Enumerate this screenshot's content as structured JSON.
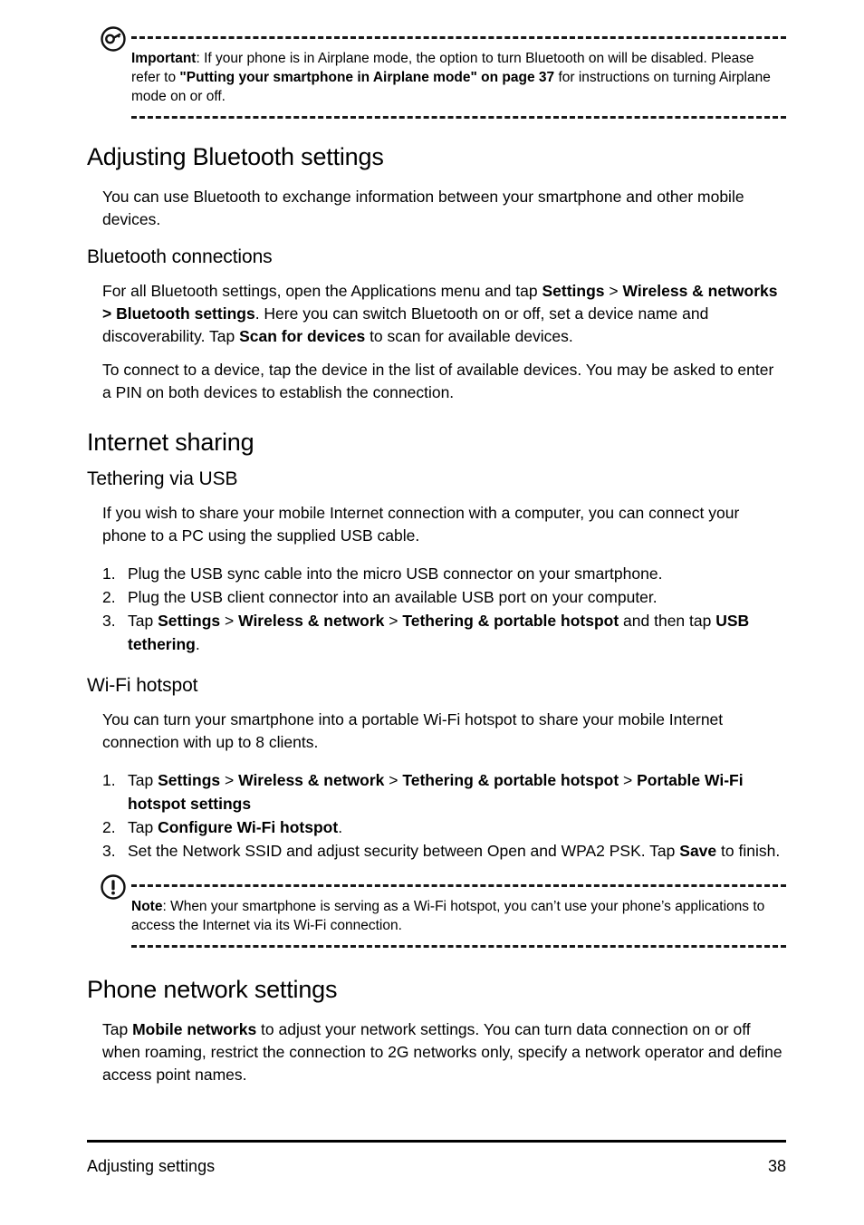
{
  "page": {
    "number": "38",
    "footer_left": "Adjusting settings"
  },
  "important_box": {
    "icon": "key-in-circle-icon",
    "label": "Important",
    "text_1": ": If your phone is in Airplane mode, the option to turn Bluetooth on will be disabled. Please refer to ",
    "bold_ref": "\"Putting your smartphone in Airplane mode\" on page 37",
    "text_2": " for instructions on turning Airplane mode on or off."
  },
  "sections": {
    "bluetooth": {
      "heading": "Adjusting Bluetooth settings",
      "intro": "You can use Bluetooth to exchange information between your smartphone and other mobile devices.",
      "sub_heading": "Bluetooth connections",
      "para1_a": "For all Bluetooth settings, open the Applications menu and tap ",
      "para1_b": "Settings",
      "para1_c": " > ",
      "para1_d": "Wireless & networks > Bluetooth settings",
      "para1_e": ". Here you can switch Bluetooth on or off, set a device name and discoverability. Tap ",
      "para1_f": "Scan for devices",
      "para1_g": " to scan for available devices.",
      "para2": "To connect to a device, tap the device in the list of available devices. You may be asked to enter a PIN on both devices to establish the connection."
    },
    "internet_sharing": {
      "heading": "Internet sharing",
      "usb": {
        "sub_heading": "Tethering via USB",
        "intro": "If you wish to share your mobile Internet connection with a computer, you can connect your phone to a PC using the supplied USB cable.",
        "steps": [
          {
            "num": "1.",
            "parts": [
              {
                "text": "Plug the USB sync cable into the micro USB connector on your smartphone.",
                "bold": false
              }
            ]
          },
          {
            "num": "2.",
            "parts": [
              {
                "text": "Plug the USB client connector into an available USB port on your computer.",
                "bold": false
              }
            ]
          },
          {
            "num": "3.",
            "parts": [
              {
                "text": "Tap ",
                "bold": false
              },
              {
                "text": "Settings",
                "bold": true
              },
              {
                "text": " > ",
                "bold": false
              },
              {
                "text": "Wireless & network",
                "bold": true
              },
              {
                "text": " > ",
                "bold": false
              },
              {
                "text": "Tethering & portable hotspot",
                "bold": true
              },
              {
                "text": " and then tap ",
                "bold": false
              },
              {
                "text": "USB tethering",
                "bold": true
              },
              {
                "text": ".",
                "bold": false
              }
            ]
          }
        ]
      },
      "wifi": {
        "sub_heading": "Wi-Fi hotspot",
        "intro": "You can turn your smartphone into a portable Wi-Fi hotspot to share your mobile Internet connection with up to 8 clients.",
        "steps": [
          {
            "num": "1.",
            "parts": [
              {
                "text": "Tap ",
                "bold": false
              },
              {
                "text": "Settings",
                "bold": true
              },
              {
                "text": " > ",
                "bold": false
              },
              {
                "text": "Wireless & network",
                "bold": true
              },
              {
                "text": " > ",
                "bold": false
              },
              {
                "text": "Tethering & portable hotspot",
                "bold": true
              },
              {
                "text": " > ",
                "bold": false
              },
              {
                "text": "Portable Wi-Fi hotspot settings",
                "bold": true
              }
            ]
          },
          {
            "num": "2.",
            "parts": [
              {
                "text": "Tap ",
                "bold": false
              },
              {
                "text": "Configure Wi-Fi hotspot",
                "bold": true
              },
              {
                "text": ".",
                "bold": false
              }
            ]
          },
          {
            "num": "3.",
            "parts": [
              {
                "text": "Set the Network SSID and adjust security between Open and WPA2 PSK. Tap ",
                "bold": false
              },
              {
                "text": "Save",
                "bold": true
              },
              {
                "text": " to finish.",
                "bold": false
              }
            ]
          }
        ]
      }
    },
    "phone_network": {
      "heading": "Phone network settings",
      "para_a": "Tap ",
      "para_b": "Mobile networks",
      "para_c": " to adjust your network settings. You can turn data connection on or off when roaming, restrict the connection to 2G networks only, specify a network operator and define access point names."
    }
  },
  "note_box": {
    "icon": "exclamation-in-circle-icon",
    "label": "Note",
    "text": ": When your smartphone is serving as a Wi-Fi hotspot, you can’t use your phone’s applications to access the Internet via its Wi-Fi connection."
  },
  "colors": {
    "text": "#000000",
    "background": "#ffffff",
    "rule": "#1a1a1a"
  }
}
